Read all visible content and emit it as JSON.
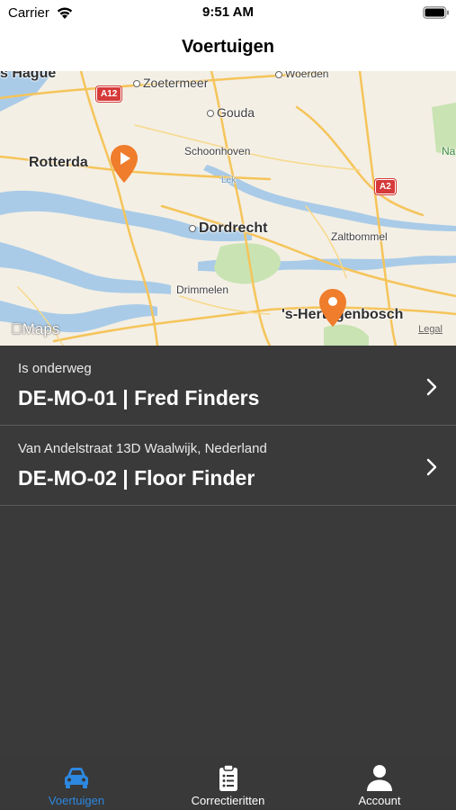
{
  "status_bar": {
    "carrier": "Carrier",
    "time": "9:51 AM"
  },
  "nav": {
    "title": "Voertuigen"
  },
  "map": {
    "labels": {
      "hague": "s Hague",
      "zoetermeer": "Zoetermeer",
      "woerden": "Woerden",
      "gouda": "Gouda",
      "rotterdam": "Rotterda",
      "schoonhoven": "Schoonhoven",
      "lek": "Lek",
      "dordrecht": "Dordrecht",
      "zaltbommel": "Zaltbommel",
      "drimmelen": "Drimmelen",
      "hertogenbosch": "'s-Hertogenbosch",
      "nap": "Nap"
    },
    "road_shields": {
      "a12": "A12",
      "a2": "A2"
    },
    "logo": "Maps",
    "legal": "Legal",
    "colors": {
      "water": "#a9cbe8",
      "land": "#f4efe4",
      "green": "#c9e3b3",
      "road": "#f5c45a",
      "pin": "#ef7d2b"
    }
  },
  "vehicles": [
    {
      "subtitle": "Is onderweg",
      "title": "DE-MO-01 | Fred Finders"
    },
    {
      "subtitle": "Van Andelstraat 13D Waalwijk, Nederland",
      "title": "DE-MO-02 | Floor Finder"
    }
  ],
  "tabbar": {
    "tabs": [
      {
        "label": "Voertuigen",
        "icon": "car-icon",
        "active": true
      },
      {
        "label": "Correctieritten",
        "icon": "clipboard-icon",
        "active": false
      },
      {
        "label": "Account",
        "icon": "person-icon",
        "active": false
      }
    ],
    "active_color": "#2d88e0"
  }
}
